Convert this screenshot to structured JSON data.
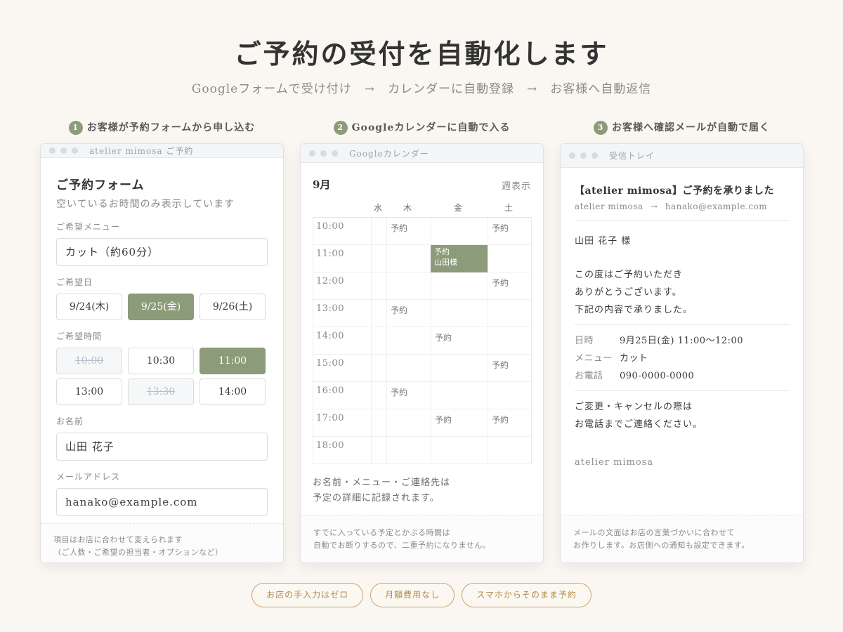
{
  "header": {
    "title": "ご予約の受付を自動化します",
    "flow": [
      "Googleフォームで受け付け",
      "カレンダーに自動登録",
      "お客様へ自動返信"
    ],
    "arrow": "→"
  },
  "steps": [
    {
      "num": "1",
      "label": "お客様が予約フォームから申し込む"
    },
    {
      "num": "2",
      "label": "Googleカレンダーに自動で入る"
    },
    {
      "num": "3",
      "label": "お客様へ確認メールが自動で届く"
    }
  ],
  "form_panel": {
    "window_title": "atelier mimosa ご予約",
    "title": "ご予約フォーム",
    "description": "空いているお時間のみ表示しています",
    "menu_label": "ご希望メニュー",
    "menu_value": "カット（約60分）",
    "date_label": "ご希望日",
    "dates": [
      "9/24(木)",
      "9/25(金)",
      "9/26(土)"
    ],
    "selected_date": "9/25(金)",
    "time_label": "ご希望時間",
    "times": [
      "10:00",
      "10:30",
      "11:00",
      "13:00",
      "13:30",
      "14:00"
    ],
    "selected_time": "11:00",
    "unavailable_times": [
      "10:00",
      "13:30"
    ],
    "name_label": "お名前",
    "name_value": "山田 花子",
    "email_label": "メールアドレス",
    "email_value": "hanako@example.com",
    "footer": [
      "項目はお店に合わせて変えられます",
      "（ご人数・ご希望の担当者・オプションなど）"
    ]
  },
  "calendar_panel": {
    "window_title": "Googleカレンダー",
    "month": "9月",
    "view": "週表示",
    "days": [
      "水",
      "木",
      "金",
      "土"
    ],
    "times": [
      "10:00",
      "11:00",
      "12:00",
      "13:00",
      "14:00",
      "15:00",
      "16:00",
      "17:00",
      "18:00"
    ],
    "events": [
      {
        "time": "10:00",
        "day": "木",
        "label": "予約"
      },
      {
        "time": "10:00",
        "day": "土",
        "label": "予約"
      },
      {
        "time": "12:00",
        "day": "土",
        "label": "予約"
      },
      {
        "time": "13:00",
        "day": "木",
        "label": "予約"
      },
      {
        "time": "14:00",
        "day": "金",
        "label": "予約"
      },
      {
        "time": "15:00",
        "day": "土",
        "label": "予約"
      },
      {
        "time": "16:00",
        "day": "木",
        "label": "予約"
      },
      {
        "time": "17:00",
        "day": "金",
        "label": "予約"
      },
      {
        "time": "17:00",
        "day": "土",
        "label": "予約"
      }
    ],
    "highlight_event": {
      "time": "11:00",
      "day": "金",
      "line1": "予約",
      "line2": "山田様"
    },
    "note": [
      "お名前・メニュー・ご連絡先は",
      "予定の詳細に記録されます。"
    ],
    "footer": [
      "すでに入っている予定とかぶる時間は",
      "自動でお断りするので、二重予約になりません。"
    ]
  },
  "mail_panel": {
    "window_title": "受信トレイ",
    "subject": "【atelier mimosa】ご予約を承りました",
    "from": "atelier mimosa",
    "to": "hanako@example.com",
    "recipient": "山田 花子 様",
    "message": [
      "この度はご予約いただき",
      "ありがとうございます。",
      "下記の内容で承りました。"
    ],
    "details": [
      {
        "key": "日時",
        "value": "9月25日(金) 11:00〜12:00"
      },
      {
        "key": "メニュー",
        "value": "カット"
      },
      {
        "key": "お電話",
        "value": "090-0000-0000"
      }
    ],
    "contact": [
      "ご変更・キャンセルの際は",
      "お電話までご連絡ください。"
    ],
    "signature": "atelier mimosa",
    "footer": [
      "メールの文面はお店の言葉づかいに合わせて",
      "お作りします。お店側への通知も設定できます。"
    ]
  },
  "badges": [
    "お店の手入力はゼロ",
    "月額費用なし",
    "スマホからそのまま予約"
  ],
  "colors": {
    "accent": "#8c9b7a",
    "badge": "#c9a66b",
    "background": "#faf7f2"
  }
}
